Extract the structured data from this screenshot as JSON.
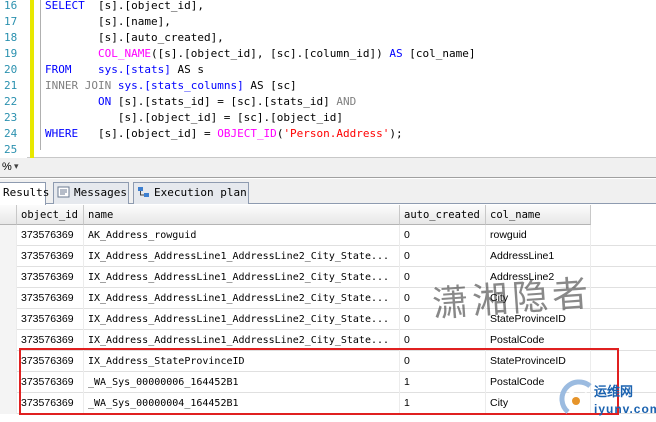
{
  "editor": {
    "lines": [
      {
        "num": "16",
        "tokens": [
          {
            "t": "SELECT  ",
            "c": "k"
          },
          {
            "t": "[s].[object_id],",
            "c": ""
          }
        ]
      },
      {
        "num": "17",
        "tokens": [
          {
            "t": "        [s].[name],",
            "c": ""
          }
        ]
      },
      {
        "num": "18",
        "tokens": [
          {
            "t": "        [s].[auto_created],",
            "c": ""
          }
        ]
      },
      {
        "num": "19",
        "tokens": [
          {
            "t": "        ",
            "c": ""
          },
          {
            "t": "COL_NAME",
            "c": "f"
          },
          {
            "t": "([s].[object_id], [sc].[column_id]) ",
            "c": ""
          },
          {
            "t": "AS",
            "c": "k"
          },
          {
            "t": " [col_name]",
            "c": ""
          }
        ]
      },
      {
        "num": "20",
        "tokens": [
          {
            "t": "FROM    ",
            "c": "k"
          },
          {
            "t": "sys.[stats]",
            "c": "k"
          },
          {
            "t": " AS s",
            "c": ""
          }
        ]
      },
      {
        "num": "21",
        "tokens": [
          {
            "t": "INNER JOIN ",
            "c": "g"
          },
          {
            "t": "sys.[stats_columns]",
            "c": "k"
          },
          {
            "t": " AS [sc]",
            "c": ""
          }
        ]
      },
      {
        "num": "22",
        "tokens": [
          {
            "t": "        ",
            "c": ""
          },
          {
            "t": "ON",
            "c": "k"
          },
          {
            "t": " [s].[stats_id] = [sc].[stats_id] ",
            "c": ""
          },
          {
            "t": "AND",
            "c": "g"
          }
        ]
      },
      {
        "num": "23",
        "tokens": [
          {
            "t": "           [s].[object_id] = [sc].[object_id]",
            "c": ""
          }
        ]
      },
      {
        "num": "24",
        "tokens": [
          {
            "t": "WHERE   ",
            "c": "k"
          },
          {
            "t": "[s].[object_id] = ",
            "c": ""
          },
          {
            "t": "OBJECT_ID",
            "c": "f"
          },
          {
            "t": "(",
            "c": ""
          },
          {
            "t": "'Person.Address'",
            "c": "s"
          },
          {
            "t": ");",
            "c": ""
          }
        ]
      },
      {
        "num": "25",
        "tokens": []
      }
    ],
    "zoom_label": "%",
    "zoom_dropdown": "▾"
  },
  "tabs": [
    {
      "label": "Results",
      "icon": "results-grid-icon",
      "active": true
    },
    {
      "label": "Messages",
      "icon": "messages-icon",
      "active": false
    },
    {
      "label": "Execution plan",
      "icon": "execution-plan-icon",
      "active": false
    }
  ],
  "grid": {
    "columns": [
      "object_id",
      "name",
      "auto_created",
      "col_name"
    ],
    "rows": [
      [
        "373576369",
        "AK_Address_rowguid",
        "0",
        "rowguid"
      ],
      [
        "373576369",
        "IX_Address_AddressLine1_AddressLine2_City_State...",
        "0",
        "AddressLine1"
      ],
      [
        "373576369",
        "IX_Address_AddressLine1_AddressLine2_City_State...",
        "0",
        "AddressLine2"
      ],
      [
        "373576369",
        "IX_Address_AddressLine1_AddressLine2_City_State...",
        "0",
        "City"
      ],
      [
        "373576369",
        "IX_Address_AddressLine1_AddressLine2_City_State...",
        "0",
        "StateProvinceID"
      ],
      [
        "373576369",
        "IX_Address_AddressLine1_AddressLine2_City_State...",
        "0",
        "PostalCode"
      ],
      [
        "373576369",
        "IX_Address_StateProvinceID",
        "0",
        "StateProvinceID"
      ],
      [
        "373576369",
        "_WA_Sys_00000006_164452B1",
        "1",
        "PostalCode"
      ],
      [
        "373576369",
        "_WA_Sys_00000004_164452B1",
        "1",
        "City"
      ]
    ]
  },
  "watermark": "潇湘隐者",
  "logo": {
    "cn": "运维网",
    "en": "iyunv.com"
  },
  "colors": {
    "keyword": "#0000ff",
    "function": "#ff00ff",
    "string": "#ff0000",
    "highlight": "#e02020"
  }
}
